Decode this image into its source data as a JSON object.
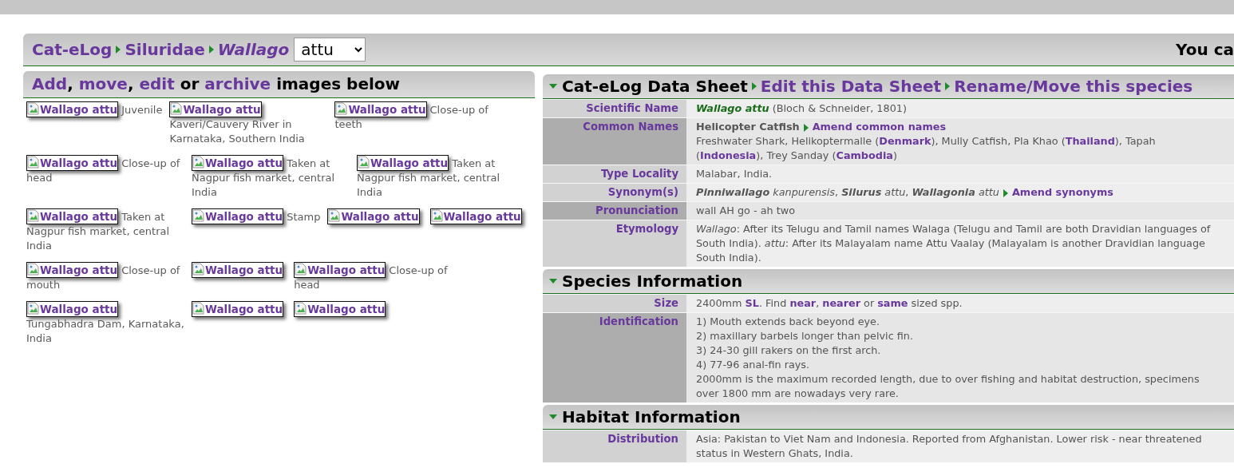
{
  "header": {
    "breadcrumb": [
      {
        "kind": "link",
        "text": "Cat-eLog"
      },
      {
        "kind": "arrow"
      },
      {
        "kind": "link",
        "text": "Siluridae"
      },
      {
        "kind": "arrow"
      },
      {
        "kind": "italic_link",
        "text": "Wallago"
      }
    ],
    "species_select": {
      "value": "attu"
    },
    "right_text": "You ca"
  },
  "gallery": {
    "heading": [
      {
        "kind": "link",
        "text": "Add"
      },
      {
        "kind": "text",
        "text": ", "
      },
      {
        "kind": "link",
        "text": "move"
      },
      {
        "kind": "text",
        "text": ", "
      },
      {
        "kind": "link",
        "text": "edit"
      },
      {
        "kind": "text",
        "text": " or "
      },
      {
        "kind": "link",
        "text": "archive"
      },
      {
        "kind": "text",
        "text": " images below"
      }
    ],
    "rows": [
      [
        {
          "alt": "Wallago attu",
          "caption": "Juvenile"
        },
        {
          "alt": "Wallago attu",
          "caption": "Kaveri/Cauvery River in Karnataka, Southern India"
        },
        {
          "alt": "Wallago attu",
          "caption": "Close-up of teeth"
        }
      ],
      [
        {
          "alt": "Wallago attu",
          "caption": "Close-up of head"
        },
        {
          "alt": "Wallago attu",
          "caption": "Taken at Nagpur fish market, central India"
        },
        {
          "alt": "Wallago attu",
          "caption": "Taken at Nagpur fish market, central India"
        }
      ],
      [
        {
          "alt": "Wallago attu",
          "caption": "Taken at Nagpur fish market, central India"
        },
        {
          "alt": "Wallago attu",
          "caption": "Stamp"
        },
        {
          "alt": "Wallago attu"
        },
        {
          "alt": "Wallago attu"
        }
      ],
      [
        {
          "alt": "Wallago attu",
          "caption": "Close-up of mouth"
        },
        {
          "alt": "Wallago attu"
        },
        {
          "alt": "Wallago attu",
          "caption": "Close-up of head"
        }
      ],
      [
        {
          "alt": "Wallago attu",
          "caption": "Tungabhadra Dam, Karnataka, India"
        },
        {
          "alt": "Wallago attu"
        },
        {
          "alt": "Wallago attu"
        }
      ]
    ]
  },
  "data_sheet": {
    "sections": [
      {
        "expanded": true,
        "title": [
          {
            "kind": "title",
            "text": "Cat-eLog Data Sheet"
          },
          {
            "kind": "arrow"
          },
          {
            "kind": "link",
            "text": "Edit this Data Sheet"
          },
          {
            "kind": "arrow"
          },
          {
            "kind": "link",
            "text": "Rename/Move this species"
          }
        ],
        "rows": [
          {
            "label": "Scientific Name",
            "highlighted": false,
            "value": [
              {
                "kind": "species",
                "text": "Wallago attu"
              },
              {
                "kind": "text",
                "text": "  (Bloch & Schneider, 1801)"
              }
            ]
          },
          {
            "label": "Common Names",
            "highlighted": true,
            "value": [
              {
                "kind": "bold",
                "text": "Helicopter Catfish"
              },
              {
                "kind": "arrow"
              },
              {
                "kind": "link",
                "text": "Amend common names"
              },
              {
                "kind": "break"
              },
              {
                "kind": "text",
                "text": "Freshwater Shark, Helikoptermalle ("
              },
              {
                "kind": "link",
                "text": "Denmark"
              },
              {
                "kind": "text",
                "text": "), Mully Catfish, Pla Khao ("
              },
              {
                "kind": "link",
                "text": "Thailand"
              },
              {
                "kind": "text",
                "text": "), Tapah ("
              },
              {
                "kind": "link",
                "text": "Indonesia"
              },
              {
                "kind": "text",
                "text": "), Trey Sanday ("
              },
              {
                "kind": "link",
                "text": "Cambodia"
              },
              {
                "kind": "text",
                "text": ")"
              }
            ]
          },
          {
            "label": "Type Locality",
            "highlighted": false,
            "value": [
              {
                "kind": "text",
                "text": "Malabar, India."
              }
            ]
          },
          {
            "label": "Synonym(s)",
            "highlighted": false,
            "value": [
              {
                "kind": "genus",
                "text": "Pinniwallago"
              },
              {
                "kind": "italic",
                "text": " kanpurensis"
              },
              {
                "kind": "text",
                "text": ", "
              },
              {
                "kind": "genus",
                "text": "Silurus"
              },
              {
                "kind": "italic",
                "text": " attu"
              },
              {
                "kind": "text",
                "text": ", "
              },
              {
                "kind": "genus",
                "text": "Wallagonia"
              },
              {
                "kind": "italic",
                "text": " attu"
              },
              {
                "kind": "arrow"
              },
              {
                "kind": "link",
                "text": "Amend synonyms"
              }
            ]
          },
          {
            "label": "Pronunciation",
            "highlighted": true,
            "value": [
              {
                "kind": "text",
                "text": "wall AH go - ah two"
              }
            ]
          },
          {
            "label": "Etymology",
            "highlighted": false,
            "value": [
              {
                "kind": "italic",
                "text": "Wallago"
              },
              {
                "kind": "text",
                "text": ": After its Telugu and Tamil names Walaga (Telugu and Tamil are both Dravidian languages of South India). "
              },
              {
                "kind": "italic",
                "text": "attu"
              },
              {
                "kind": "text",
                "text": ": After its Malayalam name Attu Vaalay (Malayalam is another Dravidian language South India)."
              }
            ]
          }
        ]
      },
      {
        "expanded": true,
        "title": [
          {
            "kind": "title",
            "text": "Species Information"
          }
        ],
        "rows": [
          {
            "label": "Size",
            "highlighted": false,
            "value": [
              {
                "kind": "text",
                "text": "2400mm "
              },
              {
                "kind": "link",
                "text": "SL"
              },
              {
                "kind": "text",
                "text": ". Find "
              },
              {
                "kind": "link",
                "text": "near"
              },
              {
                "kind": "text",
                "text": ", "
              },
              {
                "kind": "link",
                "text": "nearer"
              },
              {
                "kind": "text",
                "text": " or "
              },
              {
                "kind": "link",
                "text": "same"
              },
              {
                "kind": "text",
                "text": " sized spp."
              }
            ]
          },
          {
            "label": "Identification",
            "highlighted": true,
            "value": [
              {
                "kind": "text",
                "text": "1) Mouth extends back beyond eye."
              },
              {
                "kind": "break"
              },
              {
                "kind": "text",
                "text": "2) maxillary barbels longer than pelvic fin."
              },
              {
                "kind": "break"
              },
              {
                "kind": "text",
                "text": "3) 24-30 gill rakers on the first arch."
              },
              {
                "kind": "break"
              },
              {
                "kind": "text",
                "text": "4) 77-96 anal-fin rays."
              },
              {
                "kind": "break"
              },
              {
                "kind": "text",
                "text": "2000mm is the maximum recorded length, due to over fishing and habitat destruction, specimens over 1800 mm are nowadays very rare."
              }
            ]
          }
        ]
      },
      {
        "expanded": true,
        "title": [
          {
            "kind": "title",
            "text": "Habitat Information"
          }
        ],
        "rows": [
          {
            "label": "Distribution",
            "highlighted": false,
            "value": [
              {
                "kind": "text",
                "text": "Asia: Pakistan to Viet Nam and Indonesia. Reported from Afghanistan. Lower risk - near threatened status in Western Ghats, India."
              }
            ]
          }
        ]
      }
    ]
  }
}
